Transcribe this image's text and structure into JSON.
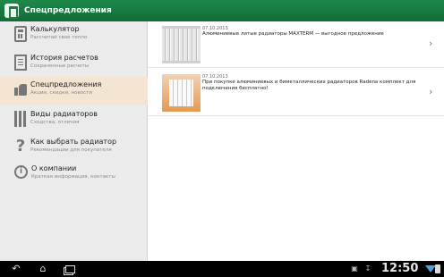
{
  "app": {
    "title": "Спецпредложения",
    "logo_icon": "app-logo-icon"
  },
  "sidebar": {
    "items": [
      {
        "title": "Калькулятор",
        "subtitle": "Рассчитай свое тепло",
        "icon": "calculator-icon"
      },
      {
        "title": "История расчетов",
        "subtitle": "Сохраненные расчеты",
        "icon": "history-icon"
      },
      {
        "title": "Спецпредложения",
        "subtitle": "Акции, скидки, новости",
        "icon": "thumbs-up-icon",
        "active": true
      },
      {
        "title": "Виды радиаторов",
        "subtitle": "Сходства, отличия",
        "icon": "radiator-icon"
      },
      {
        "title": "Как выбрать радиатор",
        "subtitle": "Рекомендации для покупателя",
        "icon": "question-icon"
      },
      {
        "title": "О компании",
        "subtitle": "Краткая информация, контакты",
        "icon": "info-icon"
      }
    ]
  },
  "offers": [
    {
      "date": "07.10.2013",
      "text": "Алюминиевые литые радиаторы MAXTERM — выгодное предложение"
    },
    {
      "date": "07.10.2013",
      "text": "При покупке алюминиевых и биметаллических радиаторов Radena комплект для подключения бесплатно!"
    }
  ],
  "statusbar": {
    "time": "12:50"
  },
  "colors": {
    "header": "#136b37",
    "active_item": "#f4e4d2",
    "sidebar_bg": "#ebebeb"
  }
}
